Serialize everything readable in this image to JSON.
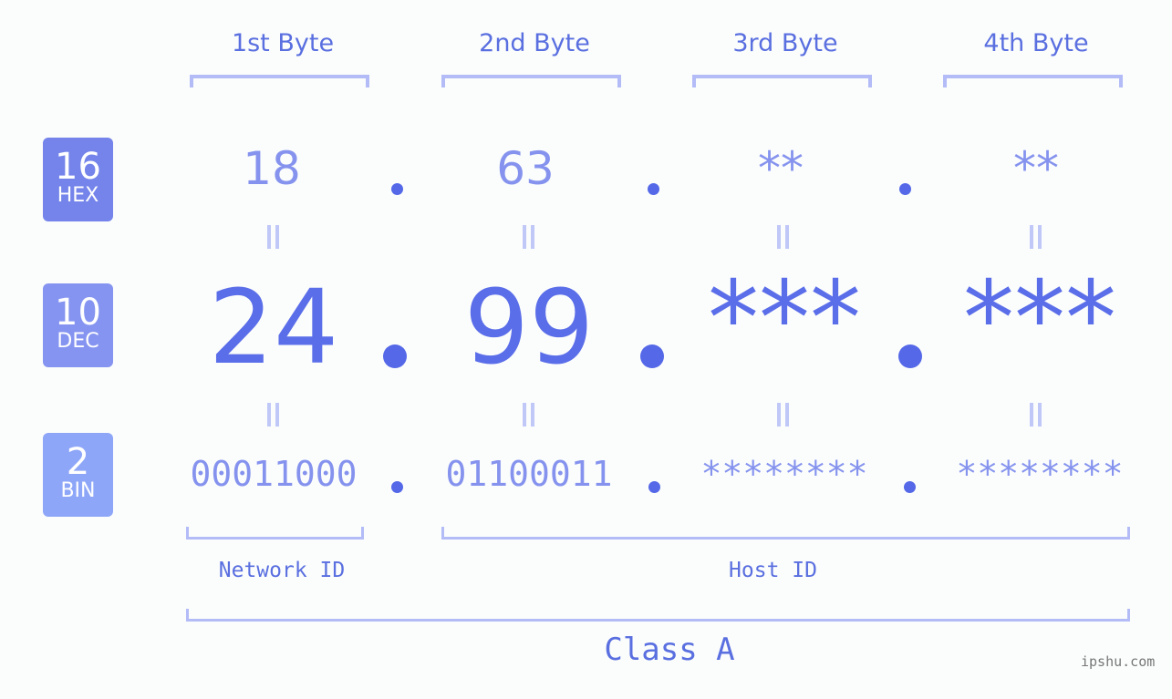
{
  "byte_headers": [
    "1st Byte",
    "2nd Byte",
    "3rd Byte",
    "4th Byte"
  ],
  "bases": [
    {
      "num": "16",
      "label": "HEX",
      "color": "#7484ea"
    },
    {
      "num": "10",
      "label": "DEC",
      "color": "#8594f0"
    },
    {
      "num": "2",
      "label": "BIN",
      "color": "#8ea6f8"
    }
  ],
  "hex": [
    "18",
    "63",
    "**",
    "**"
  ],
  "dec": [
    "24",
    "99",
    "***",
    "***"
  ],
  "bin": [
    "00011000",
    "01100011",
    "********",
    "********"
  ],
  "network_id_label": "Network ID",
  "host_id_label": "Host ID",
  "class_label": "Class A",
  "watermark": "ipshu.com"
}
